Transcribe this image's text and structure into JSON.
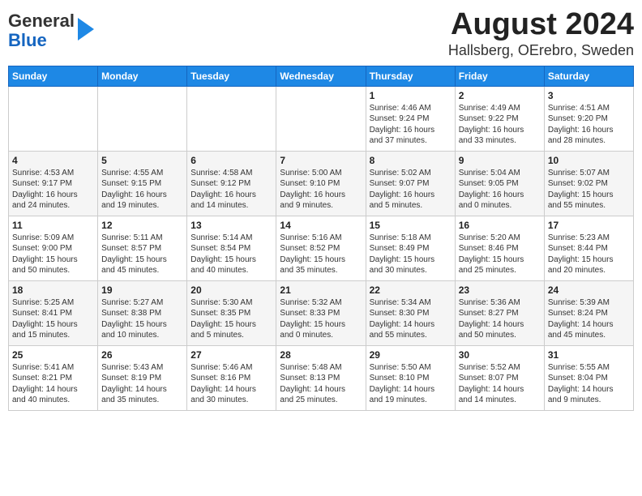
{
  "header": {
    "logo_line1": "General",
    "logo_line2": "Blue",
    "title": "August 2024",
    "subtitle": "Hallsberg, OErebro, Sweden"
  },
  "days_of_week": [
    "Sunday",
    "Monday",
    "Tuesday",
    "Wednesday",
    "Thursday",
    "Friday",
    "Saturday"
  ],
  "weeks": [
    [
      {
        "day": "",
        "info": ""
      },
      {
        "day": "",
        "info": ""
      },
      {
        "day": "",
        "info": ""
      },
      {
        "day": "",
        "info": ""
      },
      {
        "day": "1",
        "info": "Sunrise: 4:46 AM\nSunset: 9:24 PM\nDaylight: 16 hours\nand 37 minutes."
      },
      {
        "day": "2",
        "info": "Sunrise: 4:49 AM\nSunset: 9:22 PM\nDaylight: 16 hours\nand 33 minutes."
      },
      {
        "day": "3",
        "info": "Sunrise: 4:51 AM\nSunset: 9:20 PM\nDaylight: 16 hours\nand 28 minutes."
      }
    ],
    [
      {
        "day": "4",
        "info": "Sunrise: 4:53 AM\nSunset: 9:17 PM\nDaylight: 16 hours\nand 24 minutes."
      },
      {
        "day": "5",
        "info": "Sunrise: 4:55 AM\nSunset: 9:15 PM\nDaylight: 16 hours\nand 19 minutes."
      },
      {
        "day": "6",
        "info": "Sunrise: 4:58 AM\nSunset: 9:12 PM\nDaylight: 16 hours\nand 14 minutes."
      },
      {
        "day": "7",
        "info": "Sunrise: 5:00 AM\nSunset: 9:10 PM\nDaylight: 16 hours\nand 9 minutes."
      },
      {
        "day": "8",
        "info": "Sunrise: 5:02 AM\nSunset: 9:07 PM\nDaylight: 16 hours\nand 5 minutes."
      },
      {
        "day": "9",
        "info": "Sunrise: 5:04 AM\nSunset: 9:05 PM\nDaylight: 16 hours\nand 0 minutes."
      },
      {
        "day": "10",
        "info": "Sunrise: 5:07 AM\nSunset: 9:02 PM\nDaylight: 15 hours\nand 55 minutes."
      }
    ],
    [
      {
        "day": "11",
        "info": "Sunrise: 5:09 AM\nSunset: 9:00 PM\nDaylight: 15 hours\nand 50 minutes."
      },
      {
        "day": "12",
        "info": "Sunrise: 5:11 AM\nSunset: 8:57 PM\nDaylight: 15 hours\nand 45 minutes."
      },
      {
        "day": "13",
        "info": "Sunrise: 5:14 AM\nSunset: 8:54 PM\nDaylight: 15 hours\nand 40 minutes."
      },
      {
        "day": "14",
        "info": "Sunrise: 5:16 AM\nSunset: 8:52 PM\nDaylight: 15 hours\nand 35 minutes."
      },
      {
        "day": "15",
        "info": "Sunrise: 5:18 AM\nSunset: 8:49 PM\nDaylight: 15 hours\nand 30 minutes."
      },
      {
        "day": "16",
        "info": "Sunrise: 5:20 AM\nSunset: 8:46 PM\nDaylight: 15 hours\nand 25 minutes."
      },
      {
        "day": "17",
        "info": "Sunrise: 5:23 AM\nSunset: 8:44 PM\nDaylight: 15 hours\nand 20 minutes."
      }
    ],
    [
      {
        "day": "18",
        "info": "Sunrise: 5:25 AM\nSunset: 8:41 PM\nDaylight: 15 hours\nand 15 minutes."
      },
      {
        "day": "19",
        "info": "Sunrise: 5:27 AM\nSunset: 8:38 PM\nDaylight: 15 hours\nand 10 minutes."
      },
      {
        "day": "20",
        "info": "Sunrise: 5:30 AM\nSunset: 8:35 PM\nDaylight: 15 hours\nand 5 minutes."
      },
      {
        "day": "21",
        "info": "Sunrise: 5:32 AM\nSunset: 8:33 PM\nDaylight: 15 hours\nand 0 minutes."
      },
      {
        "day": "22",
        "info": "Sunrise: 5:34 AM\nSunset: 8:30 PM\nDaylight: 14 hours\nand 55 minutes."
      },
      {
        "day": "23",
        "info": "Sunrise: 5:36 AM\nSunset: 8:27 PM\nDaylight: 14 hours\nand 50 minutes."
      },
      {
        "day": "24",
        "info": "Sunrise: 5:39 AM\nSunset: 8:24 PM\nDaylight: 14 hours\nand 45 minutes."
      }
    ],
    [
      {
        "day": "25",
        "info": "Sunrise: 5:41 AM\nSunset: 8:21 PM\nDaylight: 14 hours\nand 40 minutes."
      },
      {
        "day": "26",
        "info": "Sunrise: 5:43 AM\nSunset: 8:19 PM\nDaylight: 14 hours\nand 35 minutes."
      },
      {
        "day": "27",
        "info": "Sunrise: 5:46 AM\nSunset: 8:16 PM\nDaylight: 14 hours\nand 30 minutes."
      },
      {
        "day": "28",
        "info": "Sunrise: 5:48 AM\nSunset: 8:13 PM\nDaylight: 14 hours\nand 25 minutes."
      },
      {
        "day": "29",
        "info": "Sunrise: 5:50 AM\nSunset: 8:10 PM\nDaylight: 14 hours\nand 19 minutes."
      },
      {
        "day": "30",
        "info": "Sunrise: 5:52 AM\nSunset: 8:07 PM\nDaylight: 14 hours\nand 14 minutes."
      },
      {
        "day": "31",
        "info": "Sunrise: 5:55 AM\nSunset: 8:04 PM\nDaylight: 14 hours\nand 9 minutes."
      }
    ]
  ]
}
